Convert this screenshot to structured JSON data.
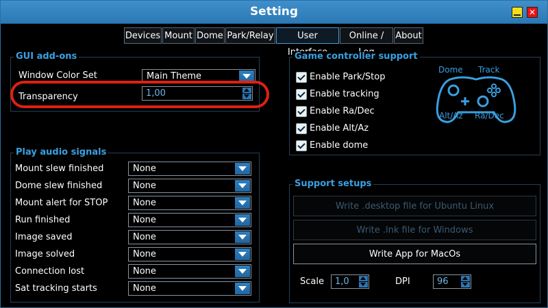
{
  "window": {
    "title": "Setting",
    "minimize_icon": "minimize-icon",
    "close_icon": "close-icon",
    "close_glyph": "✕"
  },
  "tabs": [
    "Devices",
    "Mount",
    "Dome",
    "Park/Relay",
    "User Interface",
    "Online / Log",
    "About"
  ],
  "active_tab": "User Interface",
  "gui_addons": {
    "title": "GUI add-ons",
    "window_color_label": "Window Color Set",
    "window_color_value": "Main Theme",
    "transparency_label": "Transparency",
    "transparency_value": "1,00"
  },
  "audio": {
    "title": "Play audio signals",
    "rows": [
      {
        "label": "Mount slew finished",
        "value": "None"
      },
      {
        "label": "Dome slew finished",
        "value": "None"
      },
      {
        "label": "Mount alert for STOP",
        "value": "None"
      },
      {
        "label": "Run finished",
        "value": "None"
      },
      {
        "label": "Image saved",
        "value": "None"
      },
      {
        "label": "Image solved",
        "value": "None"
      },
      {
        "label": "Connection lost",
        "value": "None"
      },
      {
        "label": "Sat tracking starts",
        "value": "None"
      }
    ]
  },
  "game_controller": {
    "title": "Game controller support",
    "options": [
      {
        "label": "Enable Park/Stop",
        "checked": true
      },
      {
        "label": "Enable tracking",
        "checked": true
      },
      {
        "label": "Enable Ra/Dec",
        "checked": true
      },
      {
        "label": "Enable Alt/Az",
        "checked": true
      },
      {
        "label": "Enable dome",
        "checked": true
      }
    ],
    "diagram_labels": {
      "dome": "Dome",
      "track": "Track",
      "altaz": "Alt/Az",
      "radec": "Ra/Dec"
    }
  },
  "support": {
    "title": "Support setups",
    "btn_ubuntu": "Write .desktop file for Ubuntu Linux",
    "btn_windows": "Write .lnk file for Windows",
    "btn_macos": "Write App for MacOs",
    "scale_label": "Scale",
    "scale_value": "1,0",
    "dpi_label": "DPI",
    "dpi_value": "96"
  },
  "colors": {
    "accent": "#3aa0e2",
    "titlebar": "#3584c0",
    "highlight": "#e02010"
  }
}
